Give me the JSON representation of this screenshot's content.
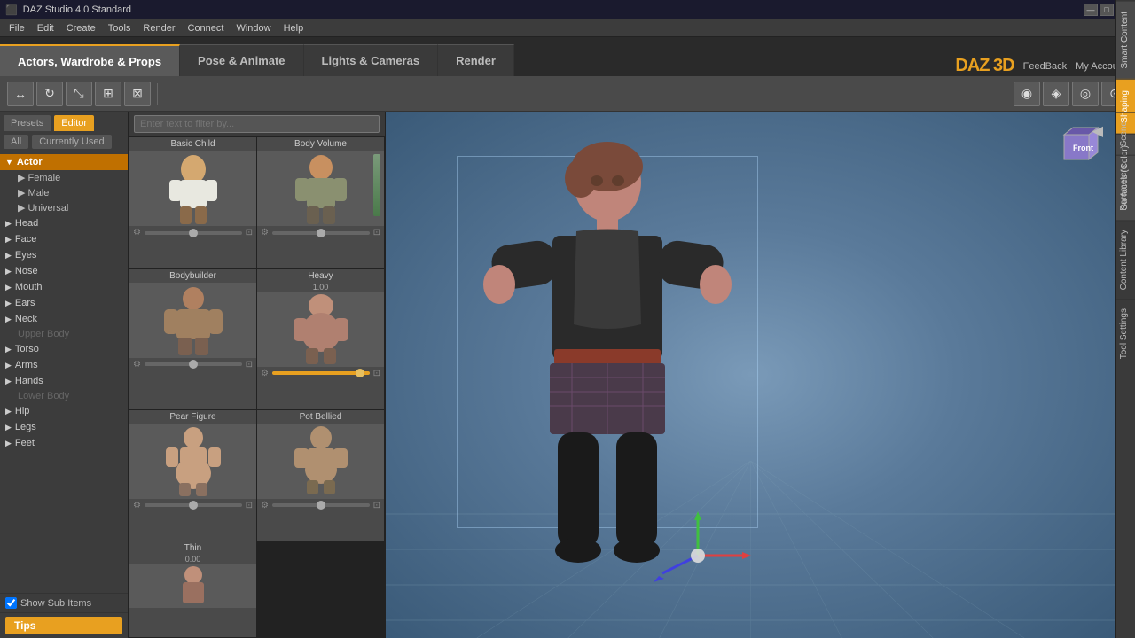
{
  "titlebar": {
    "title": "DAZ Studio 4.0 Standard",
    "min_btn": "—",
    "max_btn": "□",
    "close_btn": "✕"
  },
  "menubar": {
    "items": [
      "File",
      "Edit",
      "Create",
      "Tools",
      "Render",
      "Connect",
      "Window",
      "Help"
    ]
  },
  "navtabs": {
    "tabs": [
      {
        "label": "Actors, Wardrobe & Props",
        "active": true
      },
      {
        "label": "Pose & Animate",
        "active": false
      },
      {
        "label": "Lights & Cameras",
        "active": false
      },
      {
        "label": "Render",
        "active": false
      }
    ],
    "logo": "DAZ 3D",
    "links": [
      "FeedBack",
      "My Account"
    ]
  },
  "toolbar": {
    "left_icons": [
      "⊞",
      "⊡",
      "⊠",
      "⊛",
      "⊕",
      "⊗"
    ],
    "right_icons": [
      "◉",
      "◈",
      "◎",
      "⊙"
    ]
  },
  "left_panel": {
    "tabs": [
      {
        "label": "Presets",
        "active": false
      },
      {
        "label": "Editor",
        "active": true
      }
    ],
    "filters": [
      {
        "label": "All",
        "active": false
      },
      {
        "label": "Currently Used",
        "active": false
      }
    ],
    "tree": [
      {
        "label": "Actor",
        "type": "section",
        "active": true,
        "arrow": "▼"
      },
      {
        "label": "Female",
        "type": "child",
        "arrow": "▶"
      },
      {
        "label": "Male",
        "type": "child",
        "arrow": "▶"
      },
      {
        "label": "Universal",
        "type": "child",
        "arrow": "▶"
      },
      {
        "label": "Head",
        "type": "section",
        "arrow": "▶"
      },
      {
        "label": "Face",
        "type": "section",
        "arrow": "▶"
      },
      {
        "label": "Eyes",
        "type": "section",
        "arrow": "▶"
      },
      {
        "label": "Nose",
        "type": "section",
        "arrow": "▶"
      },
      {
        "label": "Mouth",
        "type": "section",
        "arrow": "▶"
      },
      {
        "label": "Ears",
        "type": "section",
        "arrow": "▶"
      },
      {
        "label": "Neck",
        "type": "section",
        "arrow": "▶"
      },
      {
        "label": "Upper Body",
        "type": "disabled"
      },
      {
        "label": "Torso",
        "type": "section",
        "arrow": "▶"
      },
      {
        "label": "Arms",
        "type": "section",
        "arrow": "▶"
      },
      {
        "label": "Hands",
        "type": "section",
        "arrow": "▶"
      },
      {
        "label": "Lower Body",
        "type": "disabled"
      },
      {
        "label": "Hip",
        "type": "section",
        "arrow": "▶"
      },
      {
        "label": "Legs",
        "type": "section",
        "arrow": "▶"
      },
      {
        "label": "Feet",
        "type": "section",
        "arrow": "▶"
      }
    ],
    "show_sub_items": "Show Sub Items",
    "tips_btn": "Tips"
  },
  "search": {
    "placeholder": "Enter text to filter by..."
  },
  "morphs": [
    {
      "title": "Basic Child",
      "value": "",
      "has_value": false
    },
    {
      "title": "Body Volume",
      "value": "",
      "has_value": false
    },
    {
      "title": "Bodybuilder",
      "value": "",
      "has_value": false
    },
    {
      "title": "Heavy",
      "value": "1.00",
      "has_value": true
    },
    {
      "title": "Pear Figure",
      "value": "",
      "has_value": false
    },
    {
      "title": "Pot Bellied",
      "value": "",
      "has_value": false
    },
    {
      "title": "Thin",
      "value": "0.00",
      "has_value": false
    }
  ],
  "side_tabs": [
    "Smart Content",
    "Shaping",
    "Surfaces (Color)"
  ],
  "far_tabs": [
    "Scene",
    "Parameters",
    "Content Library",
    "Tool Settings"
  ],
  "viewport": {
    "nav_icon": "◀"
  }
}
